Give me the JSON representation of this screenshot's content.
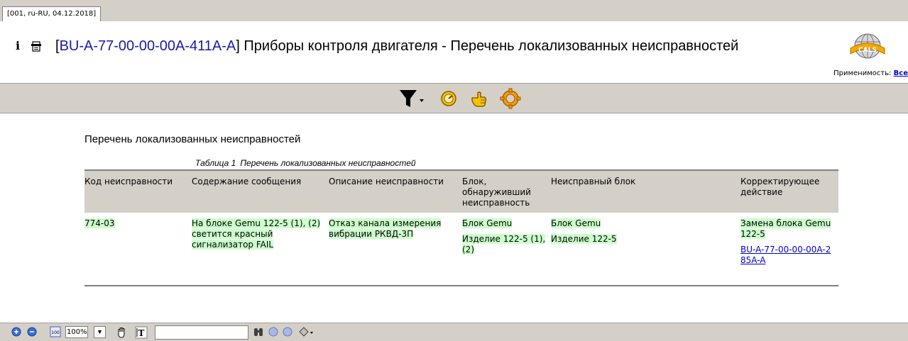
{
  "tab": {
    "label": "[001, ru-RU, 04.12.2018]"
  },
  "header": {
    "info_glyph": "i",
    "code": "BU-A-77-00-00-00A-411A-A",
    "bracket_open": "[",
    "bracket_close": "]",
    "title": " Приборы контроля двигателя - Перечень локализованных неисправностей",
    "logo_icon": "cals-globe-logo"
  },
  "applicability": {
    "label": "Применимость:",
    "link": "Все"
  },
  "toolbar": {
    "icons": [
      "filter-icon",
      "dropdown-arrow-icon",
      "gauge-icon",
      "hand-pointer-icon",
      "gear-icon"
    ]
  },
  "content": {
    "section_title": "Перечень локализованных неисправностей",
    "table_caption_label": "Таблица 1",
    "table_caption_text": "Перечень локализованных неисправностей",
    "columns": [
      "Код неисправности",
      "Содержание сообщения",
      "Описание неисправности",
      "Блок, обнаруживший неисправность",
      "Неисправный блок",
      "Корректирующее действие"
    ],
    "rows": [
      {
        "code": "774-03",
        "message": "На блоке Gemu 122-5 (1), (2) светится красный сигнализатор FAIL",
        "description": "Отказ канала измерения вибрации РКВД-3П",
        "detecting_unit": "Блок Gemu",
        "detecting_item": "Изделие 122-5 (1), (2)",
        "faulty_unit": "Блок Gemu",
        "faulty_item": "Изделие 122-5",
        "action": "Замена блока Gemu 122-5",
        "action_link": "BU-A-77-00-00-00A-285A-A"
      }
    ]
  },
  "bottombar": {
    "zoom": "100%",
    "zoom_icon_text": "100",
    "icons": [
      "zoom-in-icon",
      "zoom-out-icon",
      "zoom-percent-icon",
      "pan-hand-icon",
      "text-select-icon",
      "binoculars-icon",
      "prev-icon",
      "next-icon",
      "highlight-options-icon"
    ]
  }
}
